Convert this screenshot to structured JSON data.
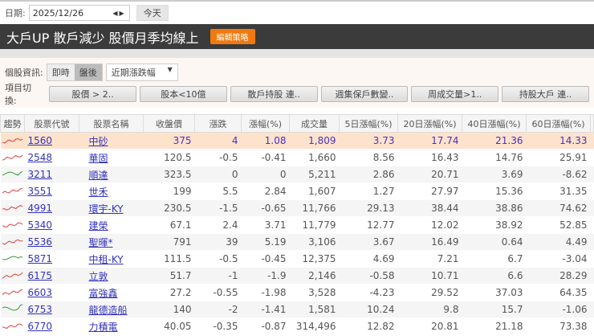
{
  "topbar": {
    "date_label": "日期:",
    "date_value": "2025/12/26",
    "today_label": "今天"
  },
  "header": {
    "title": "大戶UP 散戶減少 股價月季均線上",
    "edit_label": "編輯策略"
  },
  "controls": {
    "info_label": "個股資訊:",
    "realtime": "即時",
    "afterhours": "盤後",
    "select_value": "近期漲跌幅",
    "switch_label": "項目切換:",
    "buttons": [
      "股價 > 2..",
      "股本<10億",
      "散戶持股 連..",
      "週集保戶數變..",
      "周成交量>1..",
      "持股大戶 連.."
    ]
  },
  "table": {
    "headers": [
      "趨勢",
      "股票代號",
      "股票名稱",
      "收盤價",
      "漲跌",
      "漲幅(%)",
      "成交量",
      "5日漲幅(%)",
      "20日漲幅(%)",
      "40日漲幅(%)",
      "60日漲幅(%)"
    ],
    "rows": [
      {
        "trend": "red",
        "code": "1560",
        "name": "中砂",
        "close": "375",
        "chg": "4",
        "pct": "1.08",
        "vol": "1,809",
        "d5": "3.73",
        "d20": "17.74",
        "d40": "21.36",
        "d60": "14.33"
      },
      {
        "trend": "red",
        "code": "2548",
        "name": "華固",
        "close": "120.5",
        "chg": "-0.5",
        "pct": "-0.41",
        "vol": "1,660",
        "d5": "8.56",
        "d20": "16.43",
        "d40": "14.76",
        "d60": "25.91"
      },
      {
        "trend": "green",
        "code": "3211",
        "name": "順達",
        "close": "323.5",
        "chg": "0",
        "pct": "0",
        "vol": "5,211",
        "d5": "2.86",
        "d20": "20.71",
        "d40": "3.69",
        "d60": "-8.62"
      },
      {
        "trend": "red",
        "code": "3551",
        "name": "世禾",
        "close": "199",
        "chg": "5.5",
        "pct": "2.84",
        "vol": "1,607",
        "d5": "1.27",
        "d20": "27.97",
        "d40": "15.36",
        "d60": "31.35"
      },
      {
        "trend": "red",
        "code": "4991",
        "name": "環宇-KY",
        "close": "230.5",
        "chg": "-1.5",
        "pct": "-0.65",
        "vol": "11,766",
        "d5": "29.13",
        "d20": "38.44",
        "d40": "38.86",
        "d60": "74.62"
      },
      {
        "trend": "red",
        "code": "5340",
        "name": "建榮",
        "close": "67.1",
        "chg": "2.4",
        "pct": "3.71",
        "vol": "11,779",
        "d5": "12.77",
        "d20": "12.02",
        "d40": "38.92",
        "d60": "52.85"
      },
      {
        "trend": "red",
        "code": "5536",
        "name": "聖暉*",
        "close": "791",
        "chg": "39",
        "pct": "5.19",
        "vol": "3,106",
        "d5": "3.67",
        "d20": "16.49",
        "d40": "0.64",
        "d60": "4.49"
      },
      {
        "trend": "green",
        "code": "5871",
        "name": "中租-KY",
        "close": "111.5",
        "chg": "-0.5",
        "pct": "-0.45",
        "vol": "12,375",
        "d5": "4.69",
        "d20": "7.21",
        "d40": "6.7",
        "d60": "-3.04"
      },
      {
        "trend": "red",
        "code": "6175",
        "name": "立敦",
        "close": "51.7",
        "chg": "-1",
        "pct": "-1.9",
        "vol": "2,146",
        "d5": "-0.58",
        "d20": "10.71",
        "d40": "6.6",
        "d60": "28.29"
      },
      {
        "trend": "red",
        "code": "6603",
        "name": "富強鑫",
        "close": "27.2",
        "chg": "-0.55",
        "pct": "-1.98",
        "vol": "3,528",
        "d5": "-4.23",
        "d20": "29.52",
        "d40": "37.03",
        "d60": "64.35"
      },
      {
        "trend": "green",
        "code": "6753",
        "name": "龍德造船",
        "close": "140",
        "chg": "-2",
        "pct": "-1.41",
        "vol": "1,581",
        "d5": "10.24",
        "d20": "9.8",
        "d40": "15.7",
        "d60": "-1.06"
      },
      {
        "trend": "red",
        "code": "6770",
        "name": "力積電",
        "close": "40.05",
        "chg": "-0.35",
        "pct": "-0.87",
        "vol": "314,496",
        "d5": "12.82",
        "d20": "20.81",
        "d40": "21.18",
        "d60": "73.38"
      }
    ]
  },
  "colors": {
    "up": "#e04040",
    "down": "#3a9a3a",
    "accent": "#f07a10",
    "highlight": "#fde3cc"
  }
}
